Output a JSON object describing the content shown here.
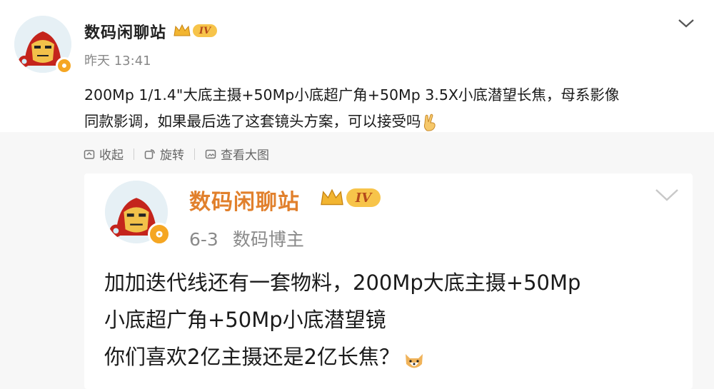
{
  "post": {
    "author": "数码闲聊站",
    "level_badge": "IV",
    "time": "昨天 13:41",
    "text_lines": [
      "200Mp 1/1.4\"大底主摄+50Mp小底超广角+50Mp 3.5X小底潜望长焦，母系影像",
      "同款影调，如果最后选了这套镜头方案，可以接受吗"
    ],
    "end_emoji": "victory-hand-emoji"
  },
  "actions": {
    "collapse": "收起",
    "rotate": "旋转",
    "view_large": "查看大图"
  },
  "quoted": {
    "author": "数码闲聊站",
    "level_badge": "IV",
    "date": "6-3",
    "role": "数码博主",
    "text_lines": [
      "加加迭代线还有一套物料，200Mp大底主摄+50Mp",
      "小底超广角+50Mp小底潜望镜",
      "你们喜欢2亿主摄还是2亿长焦？"
    ],
    "end_emoji": "dog-face-emoji"
  },
  "colors": {
    "quoted_name": "#e1802c",
    "verify_badge": "#f5a623",
    "gray_background": "#f7f7f7"
  }
}
